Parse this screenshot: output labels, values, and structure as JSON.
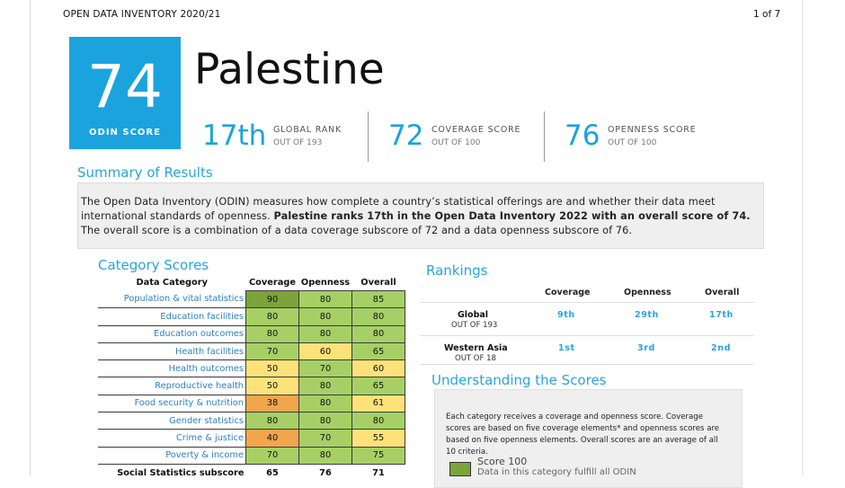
{
  "header": {
    "title": "OPEN DATA INVENTORY 2020/21",
    "page": "1 of 7"
  },
  "score": {
    "value": "74",
    "label": "ODIN SCORE"
  },
  "country": "Palestine",
  "metrics": [
    {
      "value": "17th",
      "label": "GLOBAL RANK",
      "sub": "OUT OF 193"
    },
    {
      "value": "72",
      "label": "COVERAGE SCORE",
      "sub": "OUT OF 100"
    },
    {
      "value": "76",
      "label": "OPENNESS SCORE",
      "sub": "OUT OF 100"
    }
  ],
  "summary": {
    "title": "Summary of Results",
    "text1": "The Open Data Inventory (ODIN) measures how complete a country’s statistical offerings are and whether their data meet international standards of openness. ",
    "bold": "Palestine ranks 17th in the Open Data Inventory 2022 with an overall score of 74.",
    "text2": " The overall score is a combination of a data coverage subscore of 72 and a data openness subscore of 76."
  },
  "category": {
    "title": "Category Scores",
    "headers": [
      "Data Category",
      "Coverage",
      "Openness",
      "Overall"
    ],
    "rows": [
      {
        "name": "Population & vital statistics",
        "coverage": "90",
        "openness": "80",
        "overall": "85"
      },
      {
        "name": "Education facilities",
        "coverage": "80",
        "openness": "80",
        "overall": "80"
      },
      {
        "name": "Education outcomes",
        "coverage": "80",
        "openness": "80",
        "overall": "80"
      },
      {
        "name": "Health facilities",
        "coverage": "70",
        "openness": "60",
        "overall": "65"
      },
      {
        "name": "Health outcomes",
        "coverage": "50",
        "openness": "70",
        "overall": "60"
      },
      {
        "name": "Reproductive health",
        "coverage": "50",
        "openness": "80",
        "overall": "65"
      },
      {
        "name": "Food security & nutrition",
        "coverage": "38",
        "openness": "80",
        "overall": "61"
      },
      {
        "name": "Gender statistics",
        "coverage": "80",
        "openness": "80",
        "overall": "80"
      },
      {
        "name": "Crime & justice",
        "coverage": "40",
        "openness": "70",
        "overall": "55"
      },
      {
        "name": "Poverty & income",
        "coverage": "70",
        "openness": "80",
        "overall": "75"
      }
    ],
    "subtotal": {
      "name": "Social Statistics subscore",
      "coverage": "65",
      "openness": "76",
      "overall": "71"
    }
  },
  "rankings": {
    "title": "Rankings",
    "headers": [
      "Coverage",
      "Openness",
      "Overall"
    ],
    "rows": [
      {
        "name": "Global",
        "sub": "OUT OF 193",
        "coverage": "9th",
        "openness": "29th",
        "overall": "17th"
      },
      {
        "name": "Western Asia",
        "sub": "OUT OF 18",
        "coverage": "1st",
        "openness": "3rd",
        "overall": "2nd"
      }
    ]
  },
  "understanding": {
    "title": "Understanding the Scores",
    "text": "Each category receives a coverage and openness score. Coverage scores are based on five coverage elements* and openness scores are based on five openness elements. Overall scores are an average of all 10 criteria.",
    "legend_label": "Score 100",
    "legend_desc": "Data in this category fulfill all ODIN"
  },
  "colors": {
    "accent": "#1ba3de",
    "score_high": "#7ba43a",
    "score_good": "#a6d066",
    "score_mid": "#fde27a",
    "score_low": "#f1a64d"
  }
}
